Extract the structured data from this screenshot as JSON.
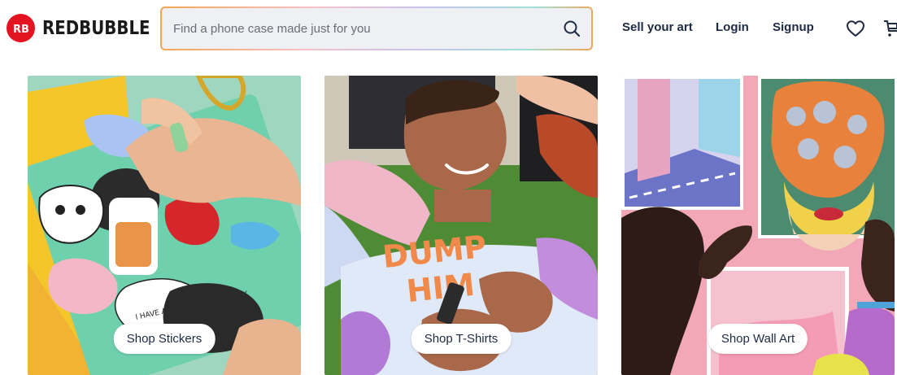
{
  "brand": {
    "name": "REDBUBBLE",
    "accent": "#e41321"
  },
  "search": {
    "placeholder": "Find a phone case made just for you",
    "icon": "search-icon"
  },
  "nav": {
    "sell": "Sell your art",
    "login": "Login",
    "signup": "Signup"
  },
  "icons": {
    "wishlist": "heart-icon",
    "cart": "cart-icon"
  },
  "tiles": [
    {
      "label": "Shop Stickers"
    },
    {
      "label": "Shop T-Shirts"
    },
    {
      "label": "Shop Wall Art"
    }
  ],
  "artwork": {
    "shirt_text": "DUMP HIM",
    "sticker_text": "I HAVE A BUBBLY PERSONALITY"
  }
}
